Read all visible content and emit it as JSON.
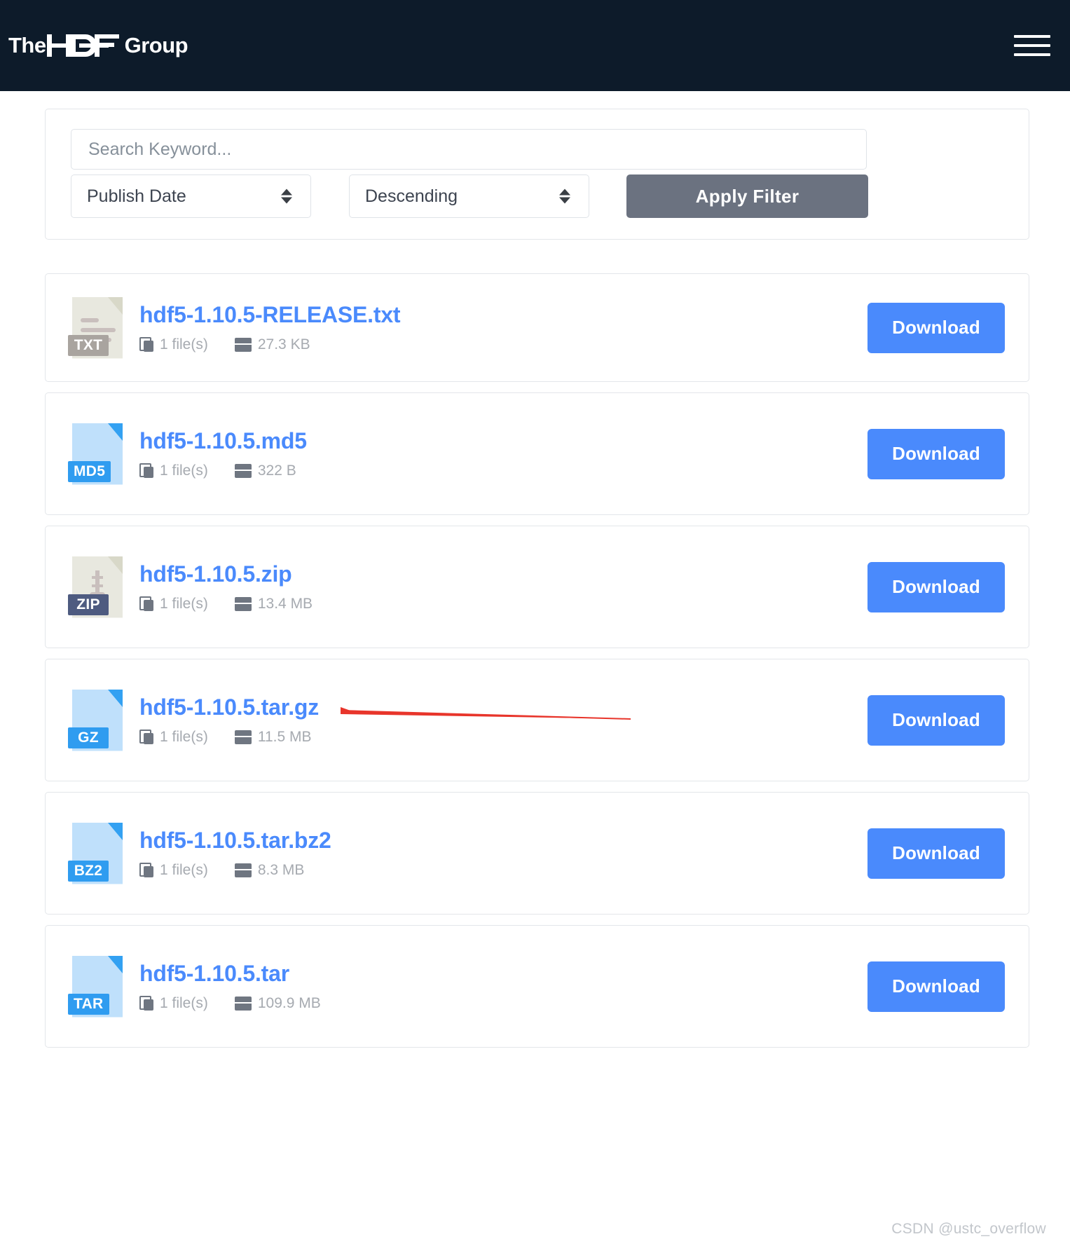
{
  "header": {
    "brand_the": "The",
    "brand_mark": "HDF",
    "brand_group": "Group",
    "menu_label": "Menu"
  },
  "filter": {
    "search_placeholder": "Search Keyword...",
    "search_value": "",
    "sort_field": "Publish Date",
    "sort_order": "Descending",
    "apply_label": "Apply Filter"
  },
  "files": [
    {
      "name": "hdf5-1.10.5-RELEASE.txt",
      "type": "TXT",
      "icon_style": "beige-txt",
      "files_count": "1 file(s)",
      "size": "27.3 KB",
      "download_label": "Download"
    },
    {
      "name": "hdf5-1.10.5.md5",
      "type": "MD5",
      "icon_style": "blue",
      "files_count": "1 file(s)",
      "size": "322 B",
      "download_label": "Download"
    },
    {
      "name": "hdf5-1.10.5.zip",
      "type": "ZIP",
      "icon_style": "beige-zip",
      "files_count": "1 file(s)",
      "size": "13.4 MB",
      "download_label": "Download"
    },
    {
      "name": "hdf5-1.10.5.tar.gz",
      "type": "GZ",
      "icon_style": "blue",
      "files_count": "1 file(s)",
      "size": "11.5 MB",
      "download_label": "Download"
    },
    {
      "name": "hdf5-1.10.5.tar.bz2",
      "type": "BZ2",
      "icon_style": "blue",
      "files_count": "1 file(s)",
      "size": "8.3 MB",
      "download_label": "Download"
    },
    {
      "name": "hdf5-1.10.5.tar",
      "type": "TAR",
      "icon_style": "blue",
      "files_count": "1 file(s)",
      "size": "109.9 MB",
      "download_label": "Download"
    }
  ],
  "annotation": {
    "color": "#e8352b",
    "points_to": "hdf5-1.10.5.tar.gz"
  },
  "watermark": "CSDN @ustc_overflow",
  "colors": {
    "header_bg": "#0d1b2a",
    "link_blue": "#4a8afc",
    "download_blue": "#4a8afc",
    "apply_grey": "#6b7280",
    "icon_blue_light": "#bfe0fb",
    "icon_blue_dark": "#2f9cf0",
    "icon_beige": "#e8e8df",
    "zip_badge": "#4e5b80"
  }
}
